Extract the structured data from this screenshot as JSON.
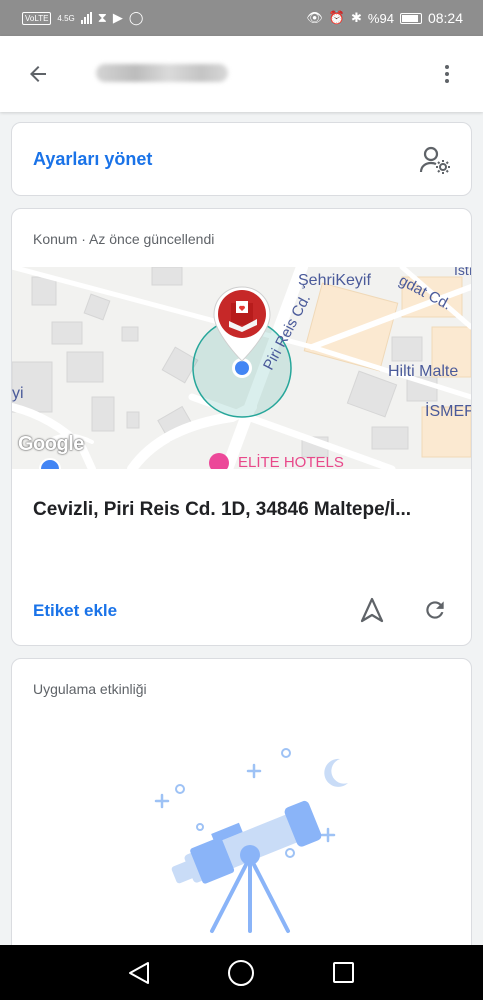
{
  "status_bar": {
    "network": "VoLTE",
    "signal": "4.5G",
    "battery": "%94",
    "time": "08:24"
  },
  "app_bar": {
    "back_icon": "arrow-left-icon",
    "more_icon": "more-vert-icon"
  },
  "manage": {
    "label": "Ayarları yönet",
    "icon": "manage-accounts-icon"
  },
  "location": {
    "header": "Konum · Az önce güncellendi",
    "map": {
      "labels": [
        "ŞehriKeyif",
        "gdat Cd.",
        "İstı",
        "Hilti Malte",
        "İSMEF",
        "yi"
      ],
      "street": "Piri Reis Cd.",
      "poi": "ELİTE HOTELS",
      "attribution": "Google"
    },
    "address": "Cevizli, Piri Reis Cd. 1D, 34846 Maltepe/İ...",
    "add_label": "Etiket ekle",
    "navigate_icon": "navigation-icon",
    "refresh_icon": "refresh-icon"
  },
  "activity": {
    "header": "Uygulama etkinliği",
    "illustration": "telescope-illustration"
  },
  "colors": {
    "accent": "#1a73e8",
    "accuracy_circle": "#34a89a",
    "pin": "#d93025"
  }
}
